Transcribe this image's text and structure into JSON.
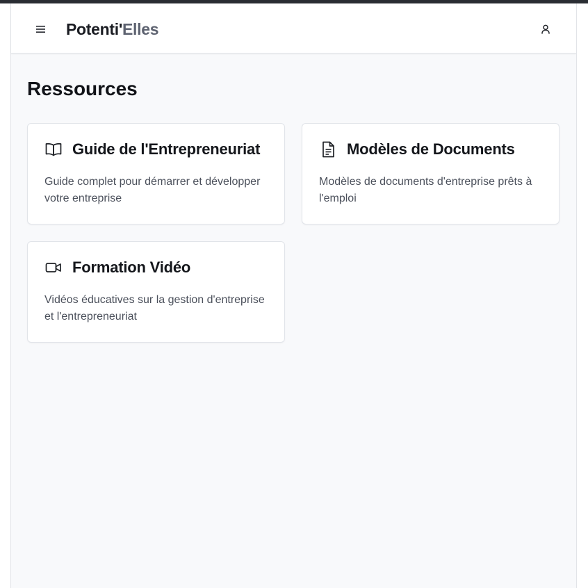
{
  "header": {
    "menu_icon": "hamburger-menu-icon",
    "brand_main": "Potenti'",
    "brand_accent": "Elles",
    "user_icon": "user-icon"
  },
  "page": {
    "title": "Ressources"
  },
  "cards": [
    {
      "icon": "open-book-icon",
      "title": "Guide de l'Entrepreneuriat",
      "description": "Guide complet pour démarrer et développer votre entreprise"
    },
    {
      "icon": "document-icon",
      "title": "Modèles de Documents",
      "description": "Modèles de documents d'entreprise prêts à l'emploi"
    },
    {
      "icon": "video-camera-icon",
      "title": "Formation Vidéo",
      "description": "Vidéos éducatives sur la gestion d'entreprise et l'entrepreneuriat"
    }
  ],
  "colors": {
    "background": "#f8f9fb",
    "card": "#ffffff",
    "text_primary": "#14161b",
    "text_secondary": "#4b505b",
    "brand_accent": "#5d6270"
  }
}
